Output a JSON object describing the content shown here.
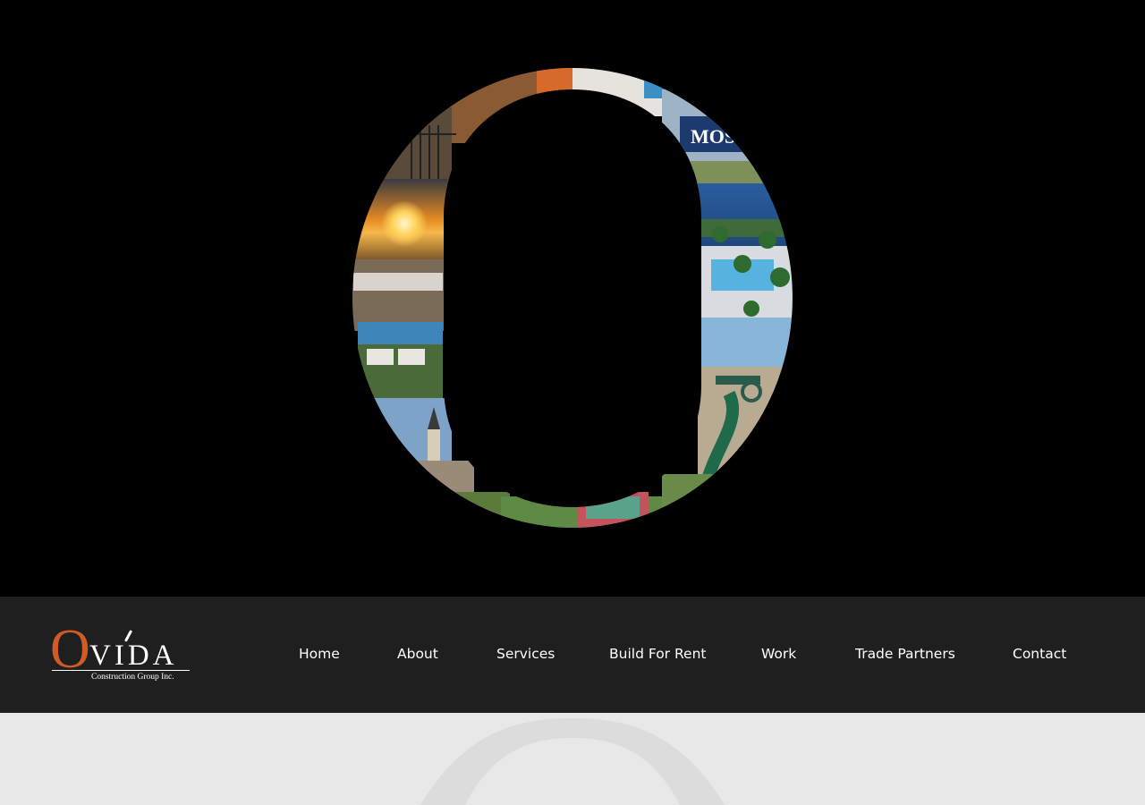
{
  "brand": {
    "logo_initial": "O",
    "logo_rest": "VIDA",
    "tagline": "Construction Group Inc.",
    "accent_color": "#d25a26"
  },
  "hero": {
    "sign_text": "MOS"
  },
  "nav": {
    "items": [
      {
        "label": "Home"
      },
      {
        "label": "About"
      },
      {
        "label": "Services"
      },
      {
        "label": "Build For Rent"
      },
      {
        "label": "Work"
      },
      {
        "label": "Trade Partners"
      },
      {
        "label": "Contact"
      }
    ]
  },
  "colors": {
    "hero_bg": "#000000",
    "nav_bg": "#201f20",
    "lower_bg": "#e8e8e8"
  }
}
